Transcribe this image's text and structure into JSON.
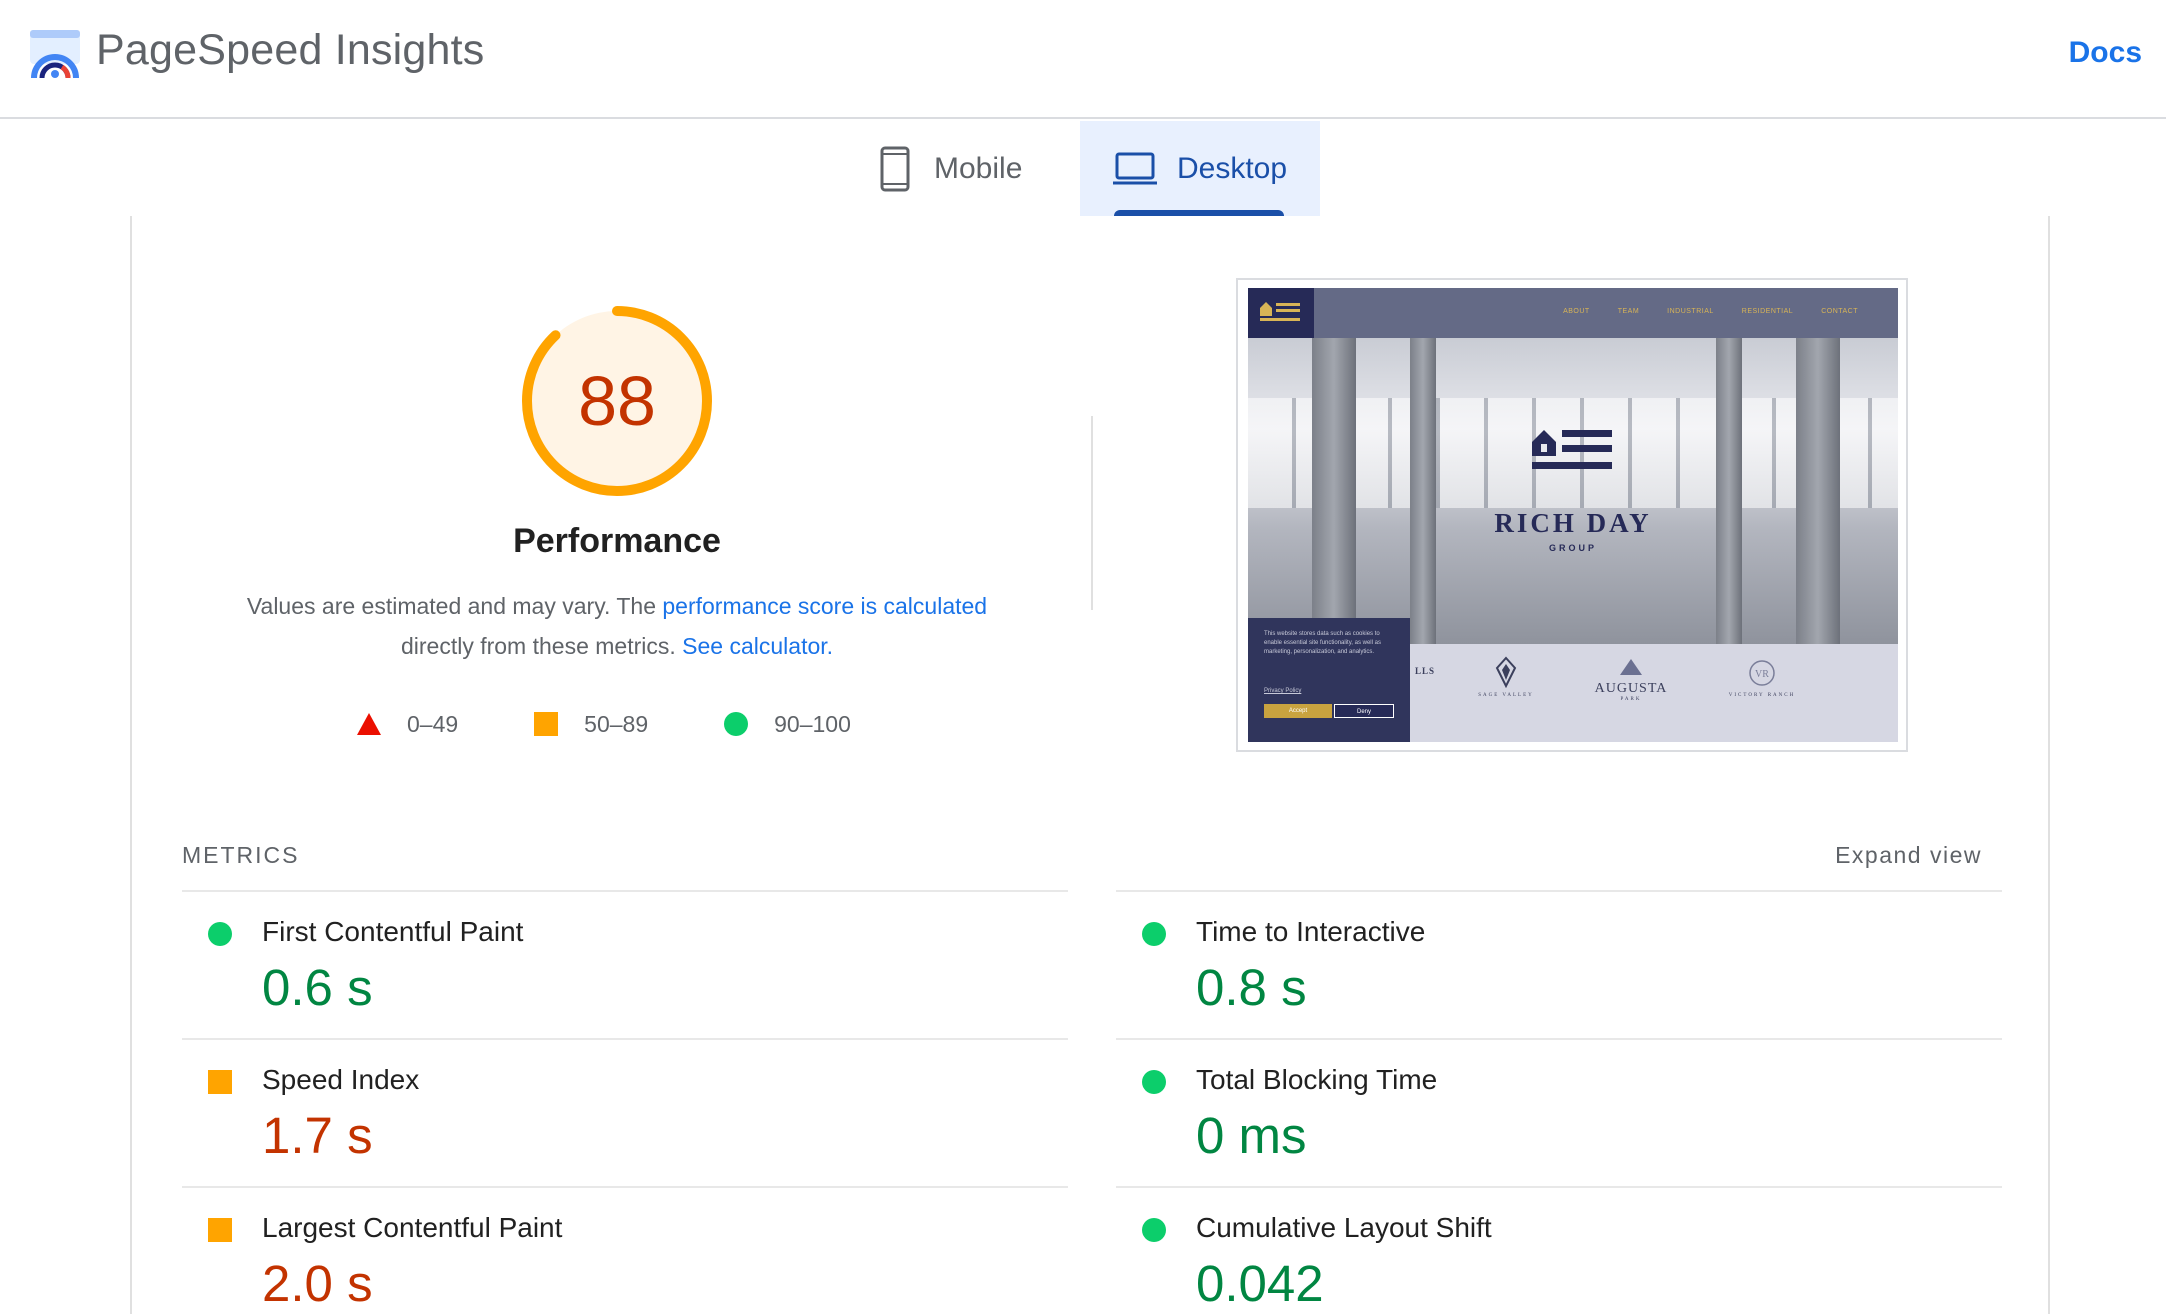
{
  "header": {
    "title": "PageSpeed Insights",
    "docs_label": "Docs"
  },
  "tabs": [
    {
      "label": "Mobile",
      "icon": "phone-icon",
      "active": false
    },
    {
      "label": "Desktop",
      "icon": "laptop-icon",
      "active": true
    }
  ],
  "performance": {
    "score": "88",
    "score_value": 88,
    "title": "Performance",
    "desc_prefix": "Values are estimated and may vary. The ",
    "desc_link": "performance score is calculated",
    "desc_middle": "directly from these metrics. ",
    "calculator_link": "See calculator.",
    "colors": {
      "fail": "#eb0f00",
      "average": "#ffa400",
      "pass": "#0cce6b",
      "score_text": "#c33300"
    }
  },
  "legend": [
    {
      "shape": "triangle",
      "range": "0–49"
    },
    {
      "shape": "square",
      "range": "50–89"
    },
    {
      "shape": "circle",
      "range": "90–100"
    }
  ],
  "screenshot": {
    "nav_links": [
      "ABOUT",
      "TEAM",
      "INDUSTRIAL",
      "RESIDENTIAL",
      "CONTACT"
    ],
    "brand": "RICH DAY",
    "brand_sub": "GROUP",
    "cookie_text": "This website stores data such as cookies to enable essential site functionality, as well as marketing, personalization, and analytics.",
    "cookie_policy": "Privacy Policy",
    "cookie_accept": "Accept",
    "cookie_deny": "Deny",
    "partners": [
      {
        "name": "LLS",
        "sub": ""
      },
      {
        "name": "",
        "sub": "SAGE VALLEY"
      },
      {
        "name": "AUGUSTA",
        "sub": "PARK"
      },
      {
        "name": "",
        "sub": "VICTORY RANCH"
      }
    ]
  },
  "metrics": {
    "label": "METRICS",
    "expand_label": "Expand view",
    "items": [
      {
        "name": "First Contentful Paint",
        "value": "0.6 s",
        "status": "pass"
      },
      {
        "name": "Time to Interactive",
        "value": "0.8 s",
        "status": "pass"
      },
      {
        "name": "Speed Index",
        "value": "1.7 s",
        "status": "average"
      },
      {
        "name": "Total Blocking Time",
        "value": "0 ms",
        "status": "pass"
      },
      {
        "name": "Largest Contentful Paint",
        "value": "2.0 s",
        "status": "average"
      },
      {
        "name": "Cumulative Layout Shift",
        "value": "0.042",
        "status": "pass"
      }
    ]
  }
}
